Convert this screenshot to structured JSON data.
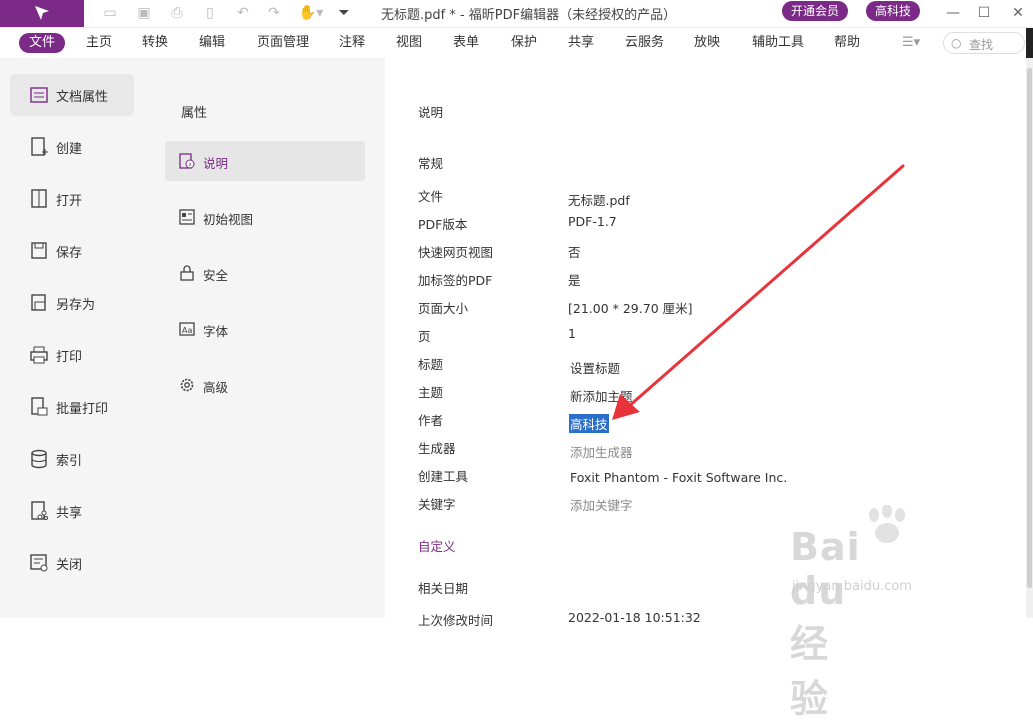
{
  "window": {
    "title": "无标题.pdf * - 福昕PDF编辑器（未经授权的产品）",
    "vip_button": "开通会员",
    "user_button": "高科技"
  },
  "menubar": {
    "items": [
      "文件",
      "主页",
      "转换",
      "编辑",
      "页面管理",
      "注释",
      "视图",
      "表单",
      "保护",
      "共享",
      "云服务",
      "放映",
      "辅助工具",
      "帮助"
    ],
    "search_placeholder": "查找"
  },
  "left_nav": {
    "items": [
      "文档属性",
      "创建",
      "打开",
      "保存",
      "另存为",
      "打印",
      "批量打印",
      "索引",
      "共享",
      "关闭"
    ]
  },
  "mid_nav": {
    "title": "属性",
    "items": [
      "说明",
      "初始视图",
      "安全",
      "字体",
      "高级"
    ]
  },
  "content": {
    "heading": "说明",
    "section_general": "常规",
    "rows": [
      {
        "label": "文件",
        "value": "无标题.pdf"
      },
      {
        "label": "PDF版本",
        "value": "PDF-1.7"
      },
      {
        "label": "快速网页视图",
        "value": "否"
      },
      {
        "label": "加标签的PDF",
        "value": "是"
      },
      {
        "label": "页面大小",
        "value": "[21.00 * 29.70 厘米]"
      },
      {
        "label": "页",
        "value": "1"
      },
      {
        "label": "标题",
        "value": "设置标题"
      },
      {
        "label": "主题",
        "value": "新添加主题"
      },
      {
        "label": "作者",
        "value": "高科技"
      },
      {
        "label": "生成器",
        "value": "添加生成器"
      },
      {
        "label": "创建工具",
        "value": "Foxit Phantom - Foxit Software Inc."
      },
      {
        "label": "关键字",
        "value": "添加关键字"
      }
    ],
    "custom_link": "自定义",
    "section_dates": "相关日期",
    "last_row_label": "上次修改时间",
    "last_row_value": "2022-01-18 10:51:32"
  },
  "watermark": {
    "brand": "Bai du 经验",
    "url": "jingyan.baidu.com"
  },
  "colors": {
    "accent": "#7b2a87",
    "selection": "#2a6fc9",
    "arrow": "#e8333a"
  }
}
